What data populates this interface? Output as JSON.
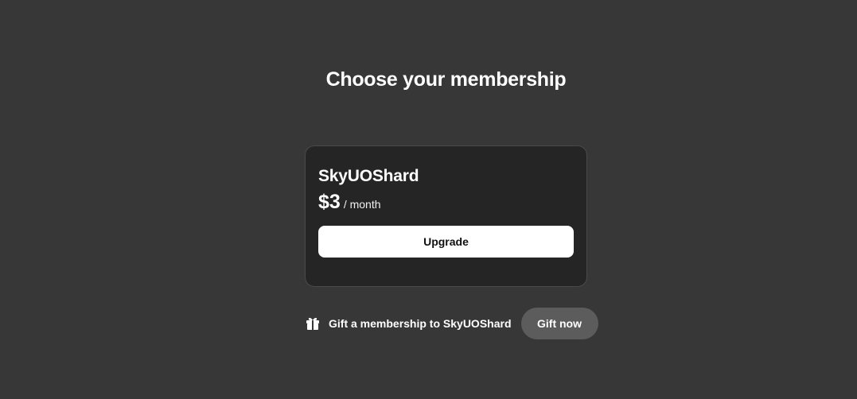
{
  "page": {
    "title": "Choose your membership"
  },
  "tier": {
    "name": "SkyUOShard",
    "price": "$3",
    "period": "/ month",
    "upgrade_label": "Upgrade"
  },
  "gift": {
    "icon": "gift-icon",
    "text": "Gift a membership to SkyUOShard",
    "button_label": "Gift now"
  },
  "colors": {
    "background": "#373737",
    "card": "#252525",
    "primary_button": "#ffffff",
    "secondary_button": "#5c5c5c"
  }
}
